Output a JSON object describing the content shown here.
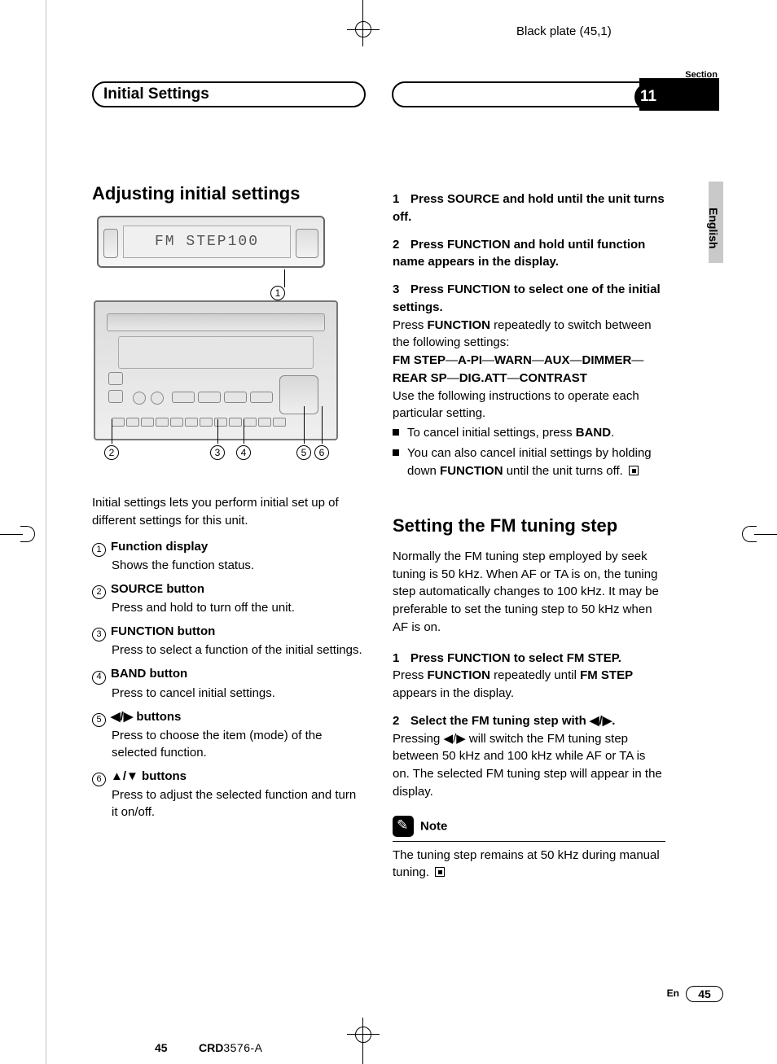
{
  "meta": {
    "black_plate": "Black plate (45,1)",
    "section_label": "Section",
    "section_number": "11",
    "section_title": "Initial Settings",
    "language_tab": "English"
  },
  "left": {
    "heading": "Adjusting initial settings",
    "display_text": "FM STEP100",
    "intro": "Initial settings lets you perform initial set up of different settings for this unit.",
    "defs": [
      {
        "num": "1",
        "title": "Function display",
        "body": "Shows the function status."
      },
      {
        "num": "2",
        "title": "SOURCE button",
        "body": "Press and hold to turn off the unit."
      },
      {
        "num": "3",
        "title": "FUNCTION button",
        "body": "Press to select a function of the initial settings."
      },
      {
        "num": "4",
        "title": "BAND button",
        "body": "Press to cancel initial settings."
      },
      {
        "num": "5",
        "title": "◀/▶ buttons",
        "body": "Press to choose the item (mode) of the selected function."
      },
      {
        "num": "6",
        "title": "▲/▼ buttons",
        "body": "Press to adjust the selected function and turn it on/off."
      }
    ]
  },
  "right": {
    "steps_a": [
      {
        "num": "1",
        "head": "Press SOURCE and hold until the unit turns off."
      },
      {
        "num": "2",
        "head": "Press FUNCTION and hold until function name appears in the display."
      },
      {
        "num": "3",
        "head": "Press FUNCTION to select one of the initial settings."
      }
    ],
    "step3_body1": "Press ",
    "step3_body1_bold": "FUNCTION",
    "step3_body1_tail": " repeatedly to switch between the following settings:",
    "settings_chain": [
      "FM STEP",
      "A-PI",
      "WARN",
      "AUX",
      "DIMMER",
      "REAR SP",
      "DIG.ATT",
      "CONTRAST"
    ],
    "step3_body2": "Use the following instructions to operate each particular setting.",
    "bullets": [
      {
        "pre": "To cancel initial settings, press ",
        "bold": "BAND",
        "post": "."
      },
      {
        "pre": "You can also cancel initial settings by holding down ",
        "bold": "FUNCTION",
        "post": " until the unit turns off."
      }
    ],
    "heading_fm": "Setting the FM tuning step",
    "fm_intro": "Normally the FM tuning step employed by seek tuning is 50 kHz. When AF or TA is on, the tuning step automatically changes to 100 kHz. It may be preferable to set the tuning step to 50 kHz when AF is on.",
    "fm_steps": [
      {
        "num": "1",
        "head": "Press FUNCTION to select FM STEP.",
        "body_pre": "Press ",
        "body_bold1": "FUNCTION",
        "body_mid": " repeatedly until ",
        "body_bold2": "FM STEP",
        "body_post": " appears in the display."
      },
      {
        "num": "2",
        "head": "Select the FM tuning step with ◀/▶.",
        "body": "Pressing ◀/▶ will switch the FM tuning step between 50 kHz and 100 kHz while AF or TA is on. The selected FM tuning step will appear in the display."
      }
    ],
    "note_label": "Note",
    "note_body": "The tuning step remains at 50 kHz during manual tuning."
  },
  "footer": {
    "en": "En",
    "page": "45",
    "left_page": "45",
    "model_prefix": "CRD",
    "model_suffix": "3576-A"
  }
}
